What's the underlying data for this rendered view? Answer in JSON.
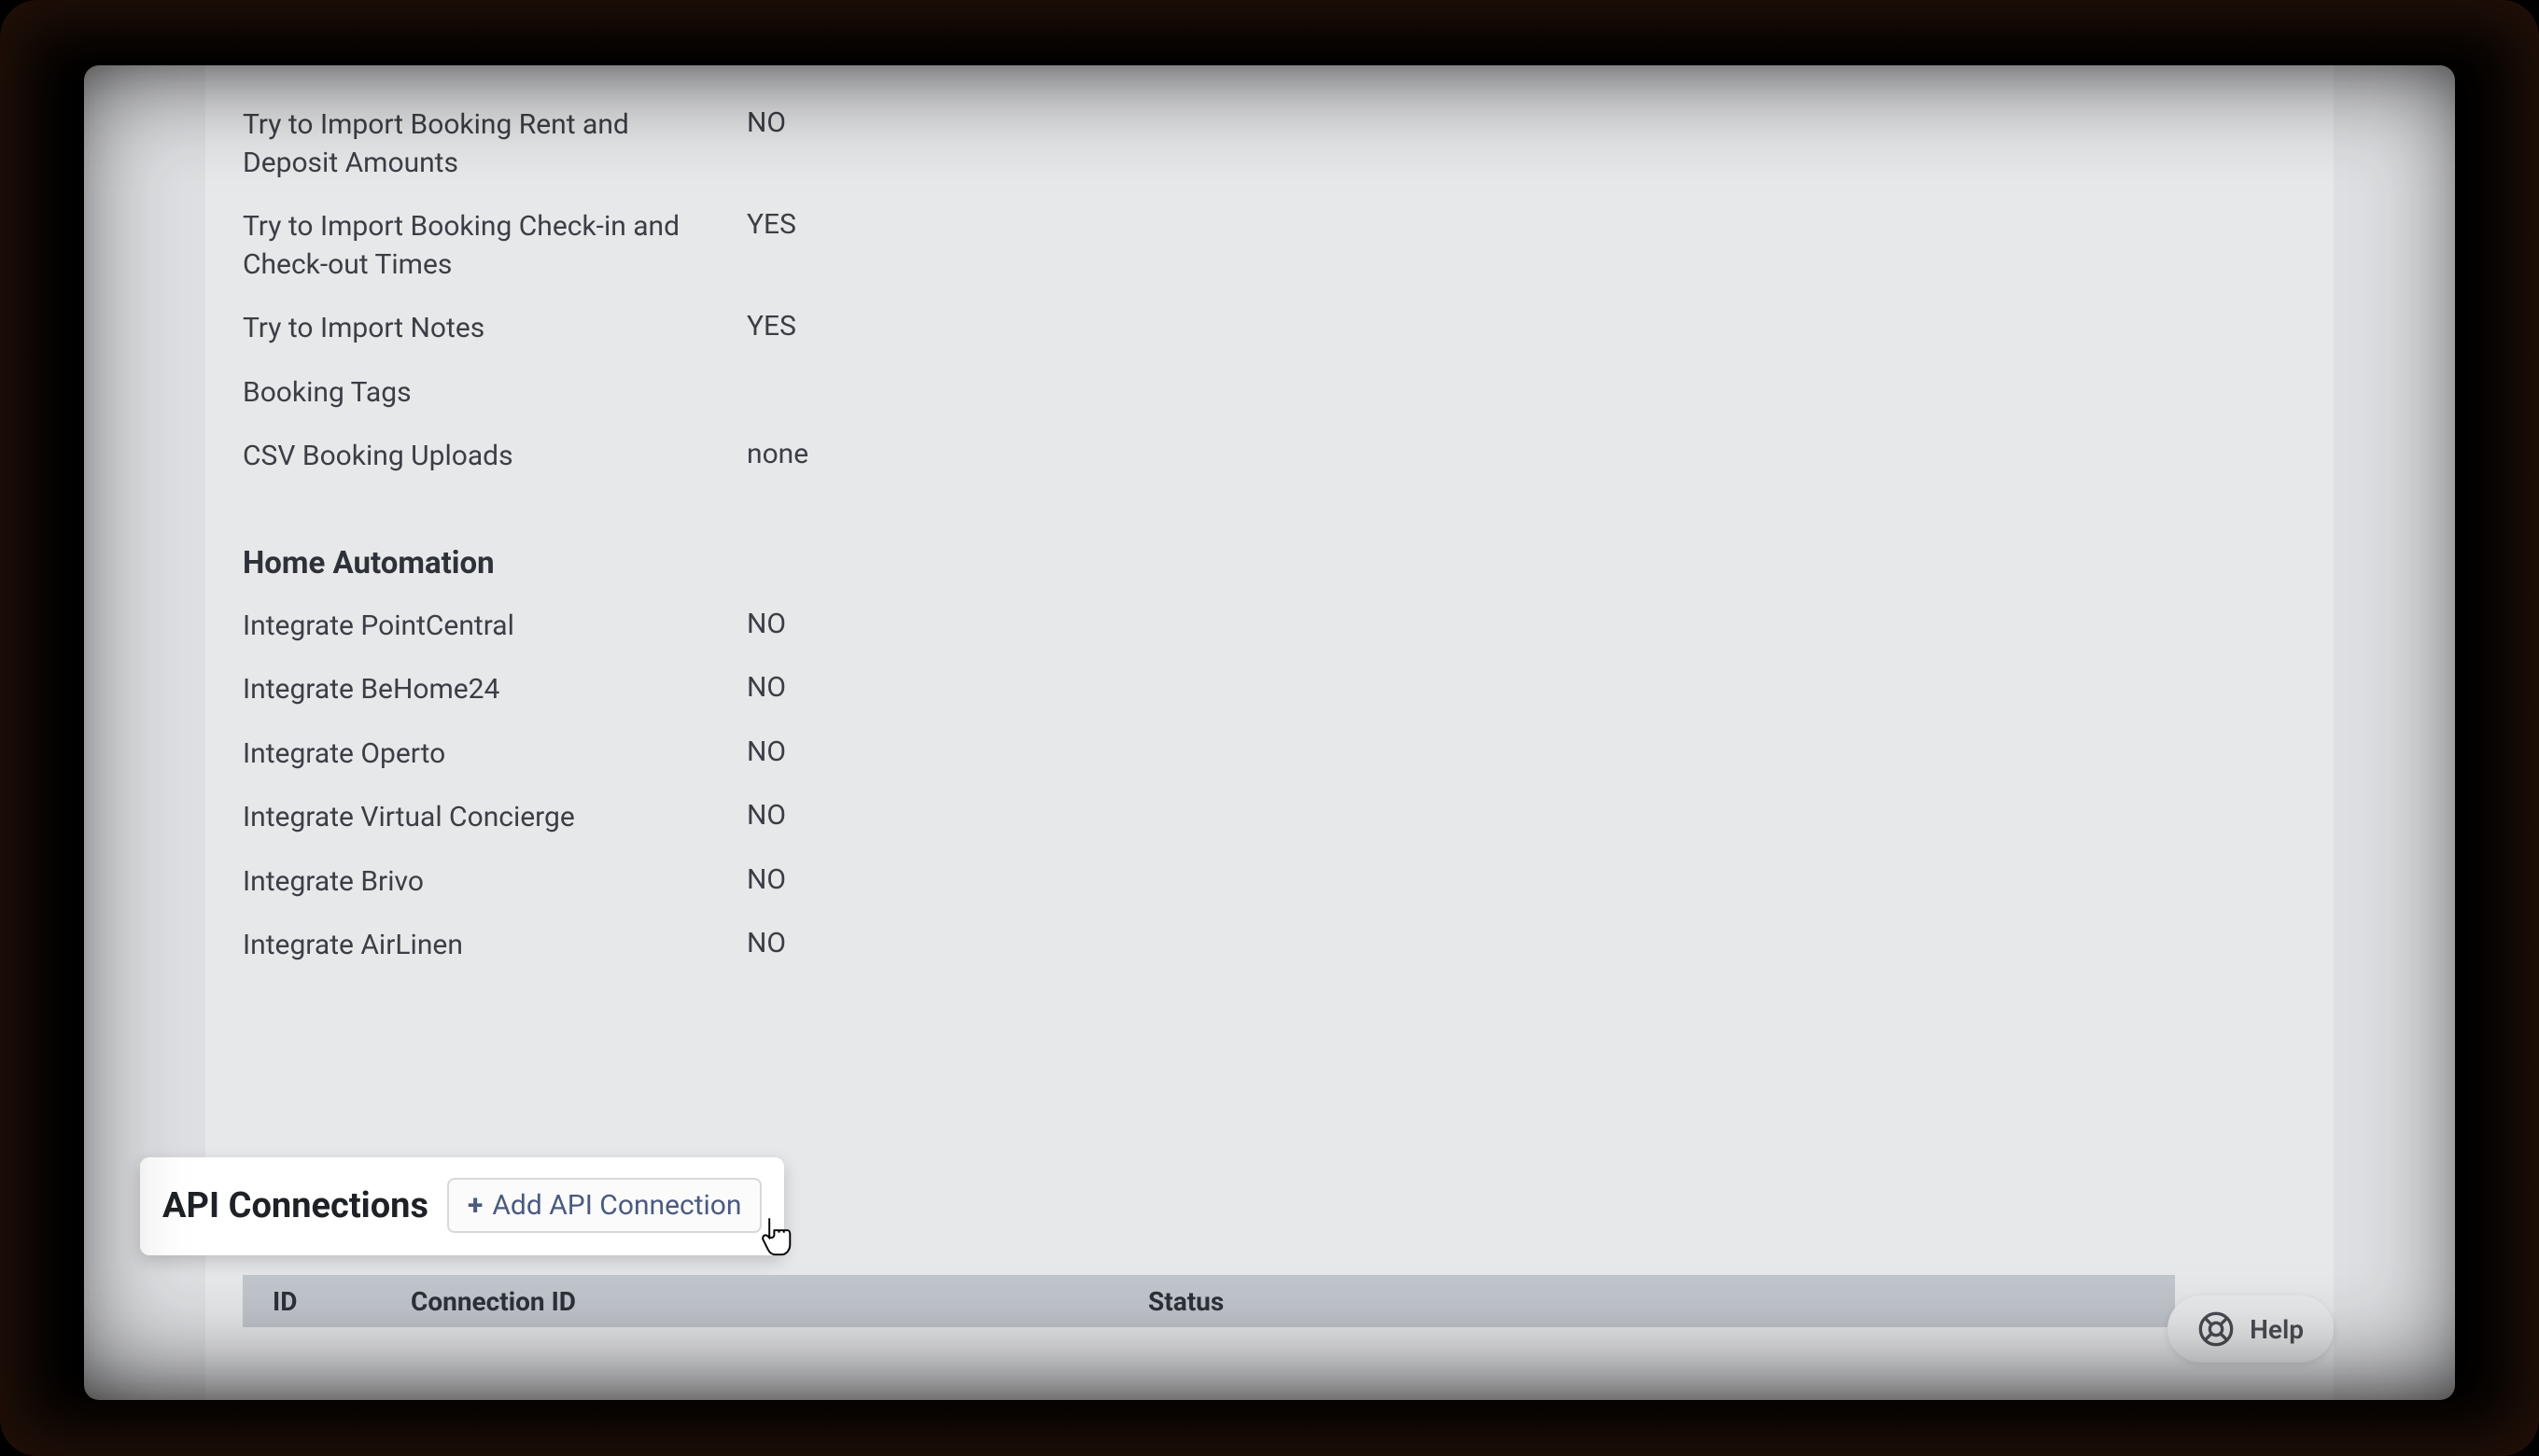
{
  "import_settings": [
    {
      "label": "Try to Import Booking Rent and Deposit Amounts",
      "value": "NO"
    },
    {
      "label": "Try to Import Booking Check-in and Check-out Times",
      "value": "YES"
    },
    {
      "label": "Try to Import Notes",
      "value": "YES"
    },
    {
      "label": "Booking Tags",
      "value": ""
    },
    {
      "label": "CSV Booking Uploads",
      "value": "none"
    }
  ],
  "home_automation": {
    "heading": "Home Automation",
    "items": [
      {
        "label": "Integrate PointCentral",
        "value": "NO"
      },
      {
        "label": "Integrate BeHome24",
        "value": "NO"
      },
      {
        "label": "Integrate Operto",
        "value": "NO"
      },
      {
        "label": "Integrate Virtual Concierge",
        "value": "NO"
      },
      {
        "label": "Integrate Brivo",
        "value": "NO"
      },
      {
        "label": "Integrate AirLinen",
        "value": "NO"
      }
    ]
  },
  "api_connections": {
    "heading": "API Connections",
    "add_button_label": "Add API Connection",
    "table": {
      "col_id": "ID",
      "col_connection_id": "Connection ID",
      "col_status": "Status"
    }
  },
  "help": {
    "label": "Help"
  }
}
